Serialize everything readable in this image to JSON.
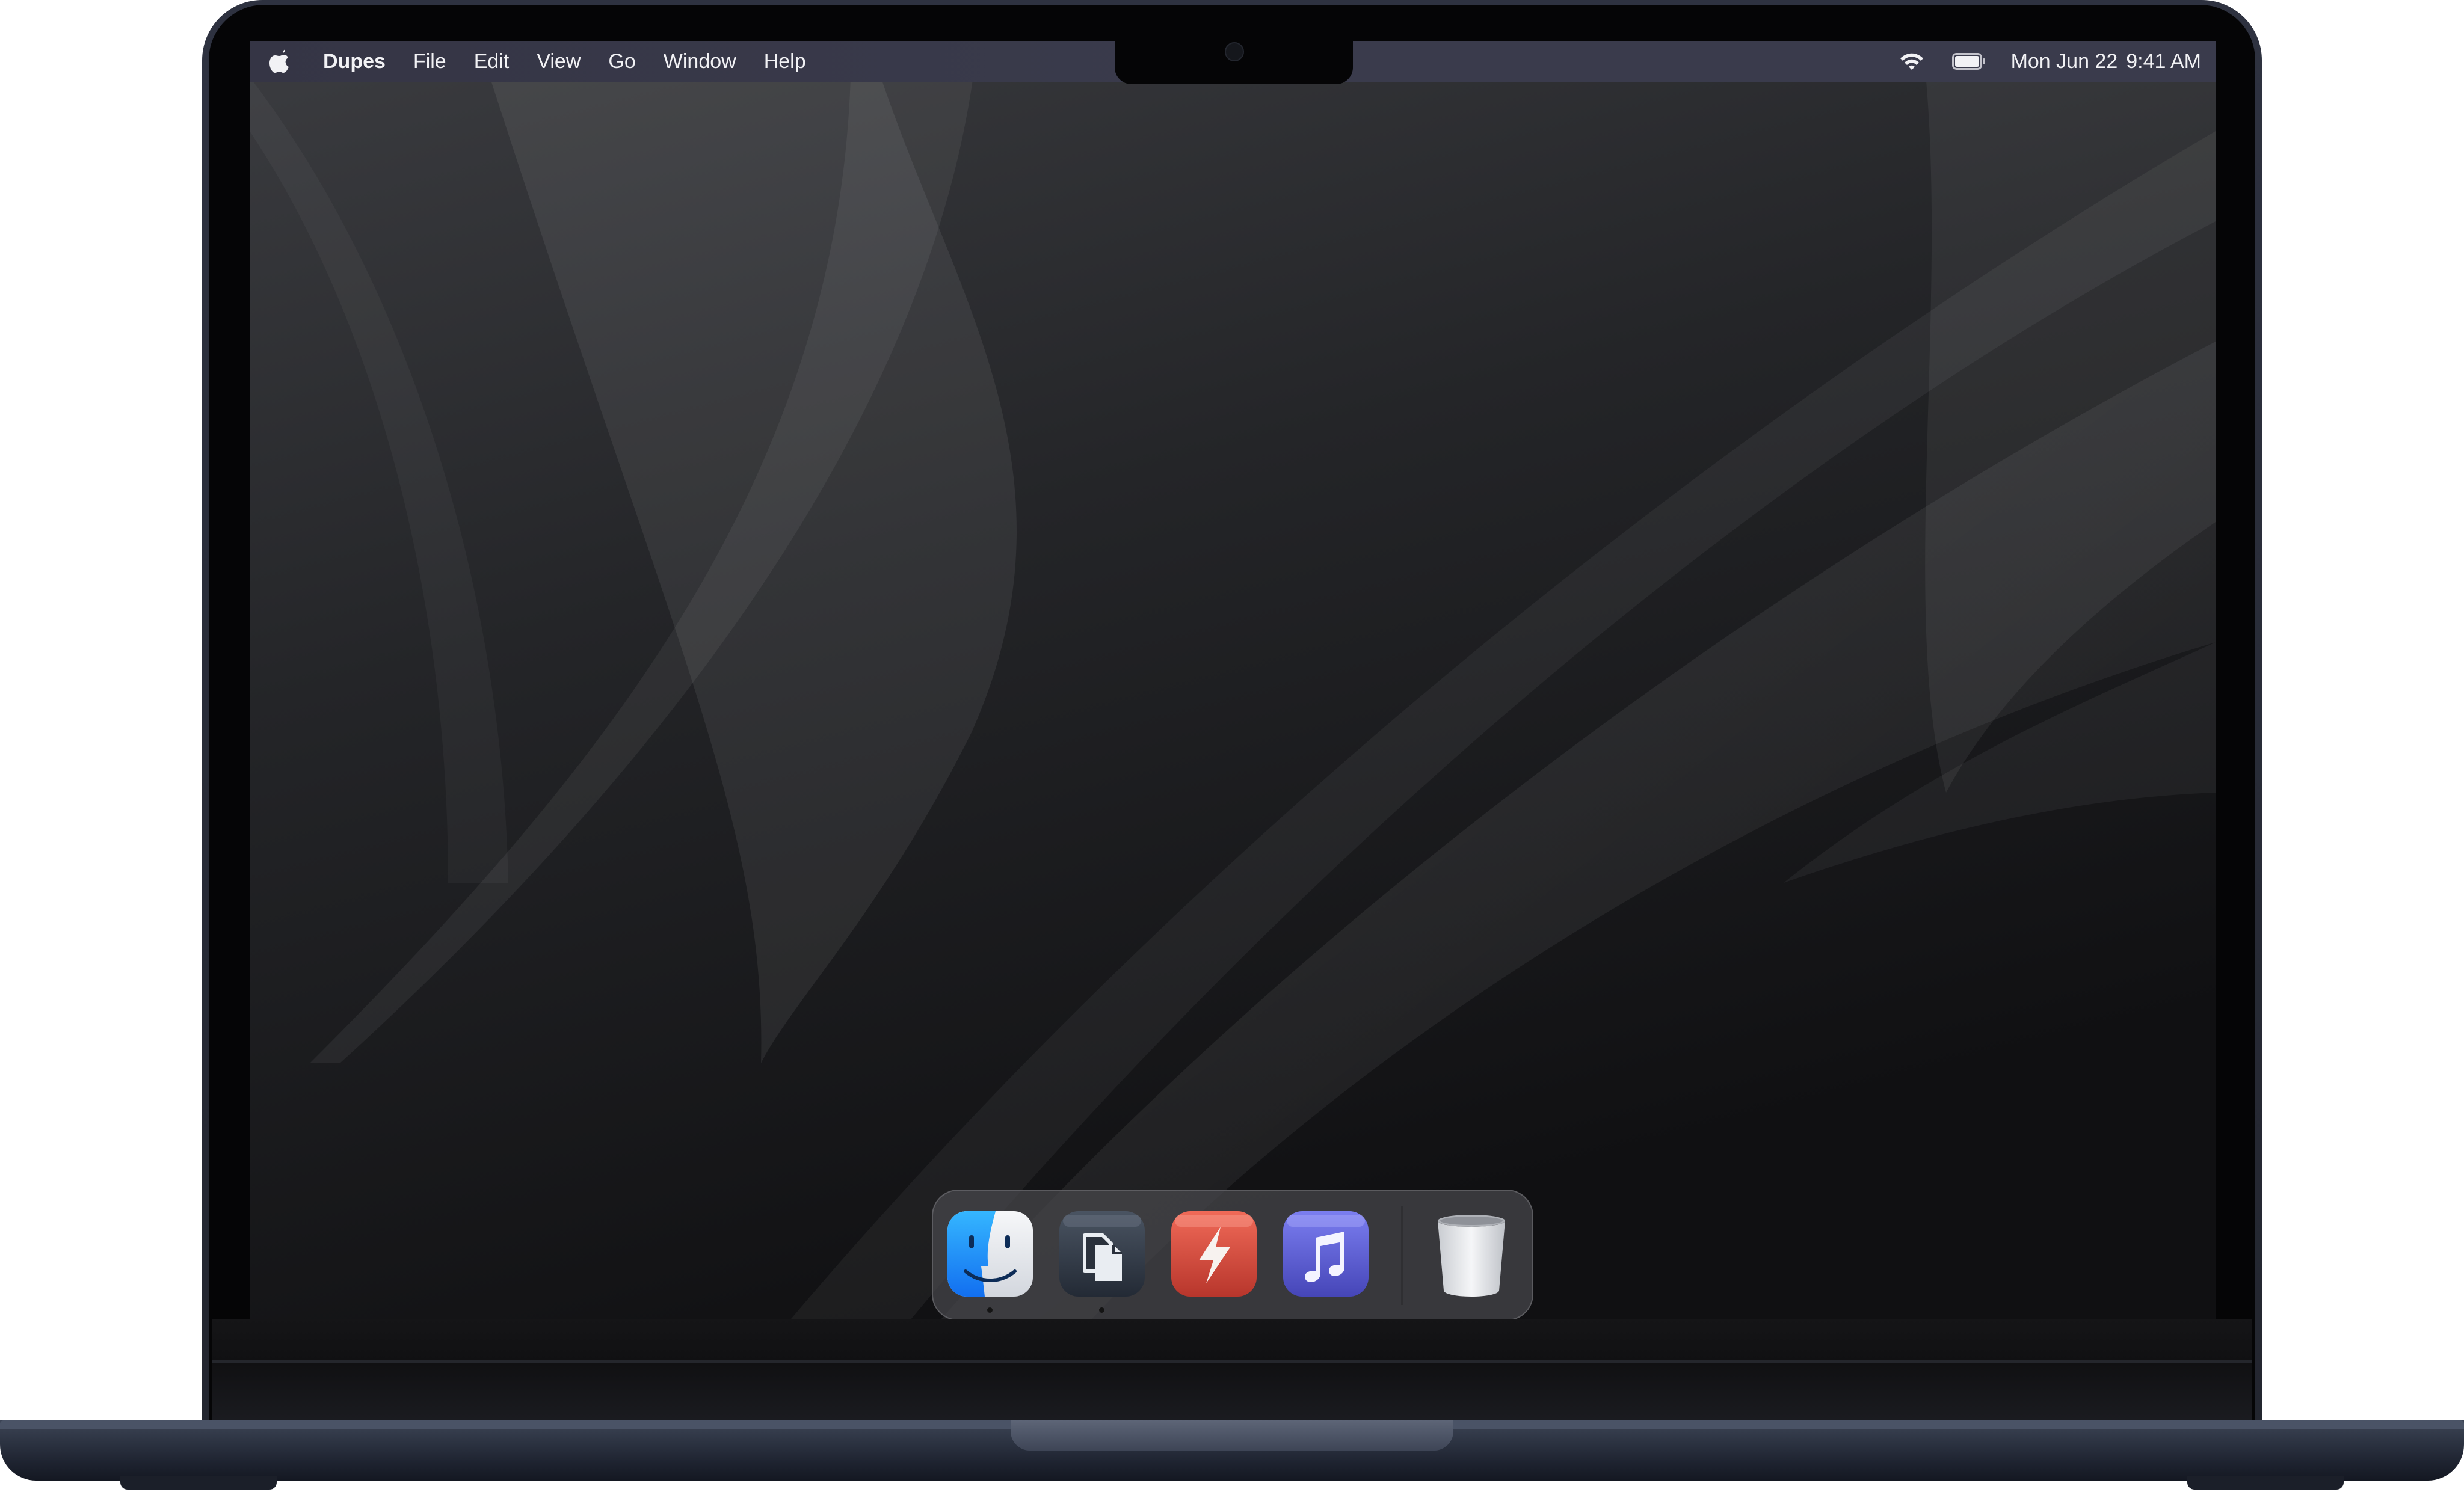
{
  "menubar": {
    "apple_menu_icon": "apple-logo-icon",
    "app_name": "Dupes",
    "menus": [
      "File",
      "Edit",
      "View",
      "Go",
      "Window",
      "Help"
    ],
    "status_icons": [
      "wifi-icon",
      "battery-icon"
    ],
    "date": "Mon Jun 22",
    "time": "9:41 AM"
  },
  "dock": {
    "apps": [
      {
        "icon": "finder-icon",
        "running": true
      },
      {
        "icon": "dupes-app-icon",
        "running": true
      },
      {
        "icon": "reeder-app-icon",
        "running": false
      },
      {
        "icon": "music-app-icon",
        "running": false
      }
    ],
    "trash_icon": "trash-icon"
  },
  "colors": {
    "menubar_bg": "#3a3b4c",
    "wallpaper_base": "#1f1f21",
    "device_body": "#2e3240",
    "finder_blue": "#1b8df5",
    "dupes_dark": "#2f3743",
    "reeder_red": "#d9483b",
    "music_purple": "#5b5ccd"
  }
}
